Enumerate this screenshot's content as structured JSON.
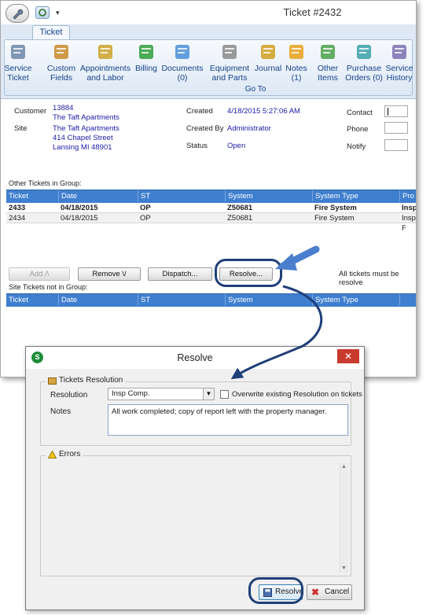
{
  "window": {
    "title": "Ticket #2432"
  },
  "ribbon": {
    "tab": "Ticket",
    "group_label": "Go To",
    "buttons": [
      {
        "line1": "Service",
        "line2": "Ticket",
        "icon": "wrench-icon"
      },
      {
        "line1": "Custom",
        "line2": "Fields",
        "icon": "form-icon"
      },
      {
        "line1": "Appointments",
        "line2": "and Labor",
        "icon": "alarm-clock-icon"
      },
      {
        "line1": "Billing",
        "line2": "",
        "icon": "dollar-icon"
      },
      {
        "line1": "Documents",
        "line2": "(0)",
        "icon": "document-icon"
      },
      {
        "line1": "Equipment",
        "line2": "and Parts",
        "icon": "equipment-icon"
      },
      {
        "line1": "Journal",
        "line2": "",
        "icon": "journal-icon"
      },
      {
        "line1": "Notes",
        "line2": "(1)",
        "icon": "note-icon"
      },
      {
        "line1": "Other",
        "line2": "Items",
        "icon": "tag-icon"
      },
      {
        "line1": "Purchase",
        "line2": "Orders (0)",
        "icon": "purchase-order-icon"
      },
      {
        "line1": "Service",
        "line2": "History",
        "icon": "history-icon"
      }
    ]
  },
  "form": {
    "customer_label": "Customer",
    "customer_number": "13884",
    "customer_name": "The Taft Apartments",
    "site_label": "Site",
    "site_name": "The Taft Apartments",
    "site_street": "414 Chapel Street",
    "site_city": "Lansing MI 48901",
    "created_label": "Created",
    "created_value": "4/18/2015 5:27:06 AM",
    "created_by_label": "Created By",
    "created_by_value": "Administrator",
    "status_label": "Status",
    "status_value": "Open",
    "contact_label": "Contact",
    "phone_label": "Phone",
    "notify_label": "Notify"
  },
  "group_grid": {
    "label": "Other Tickets in Group:",
    "columns": [
      "Ticket",
      "Date",
      "ST",
      "System",
      "System Type",
      "Pro"
    ],
    "rows": [
      {
        "ticket": "2433",
        "date": "04/18/2015",
        "st": "OP",
        "system": "Z50681",
        "type": "Fire System",
        "pro": "Insp"
      },
      {
        "ticket": "2434",
        "date": "04/18/2015",
        "st": "OP",
        "system": "Z50681",
        "type": "Fire System",
        "pro": "Insp-F"
      }
    ]
  },
  "actions": {
    "add": "Add /\\",
    "remove": "Remove \\/",
    "dispatch": "Dispatch...",
    "resolve": "Resolve...",
    "note": "All tickets must be resolve"
  },
  "site_grid": {
    "label": "Site Tickets not in Group:",
    "columns": [
      "Ticket",
      "Date",
      "ST",
      "System",
      "System Type"
    ]
  },
  "dialog": {
    "title": "Resolve",
    "close": "✕",
    "resolution_group": "Tickets Resolution",
    "resolution_label": "Resolution",
    "resolution_value": "Insp Comp.",
    "overwrite_label": "Overwrite existing Resolution on tickets",
    "notes_label": "Notes",
    "notes_value": "All work completed; copy of report left with the property manager.",
    "errors_group": "Errors",
    "resolve_button": "Resolve",
    "cancel_button": "Cancel"
  },
  "colors": {
    "grid_header": "#3f7fcf",
    "link_text": "#1c1ca8",
    "callout": "#4a7fce",
    "ring": "#1f3f78"
  }
}
